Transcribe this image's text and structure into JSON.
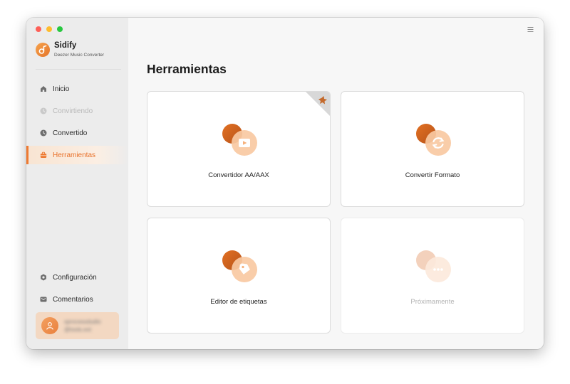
{
  "brand": {
    "name": "Sidify",
    "subtitle": "Deezer Music Converter",
    "accent": "#ee7a32"
  },
  "sidebar": {
    "items": [
      {
        "label": "Inicio",
        "icon": "home-icon"
      },
      {
        "label": "Convirtiendo",
        "icon": "converting-clock-icon",
        "state": "disabled"
      },
      {
        "label": "Convertido",
        "icon": "history-clock-icon"
      },
      {
        "label": "Herramientas",
        "icon": "toolbox-icon",
        "state": "active"
      }
    ],
    "bottom_items": [
      {
        "label": "Configuración",
        "icon": "settings-gear-icon"
      },
      {
        "label": "Comentarios",
        "icon": "mail-icon"
      }
    ]
  },
  "account": {
    "line1": "sprocessdudio",
    "line2": "@tools.ext"
  },
  "main": {
    "title": "Herramientas",
    "tools": [
      {
        "label": "Convertidor AA/AAX",
        "icon": "play-video-icon",
        "badge": "new-corner-badge"
      },
      {
        "label": "Convertir Formato",
        "icon": "refresh-cycle-icon"
      },
      {
        "label": "Editor de etiquetas",
        "icon": "tag-icon"
      },
      {
        "label": "Próximamente",
        "icon": "more-dots-icon",
        "state": "disabled"
      }
    ]
  }
}
